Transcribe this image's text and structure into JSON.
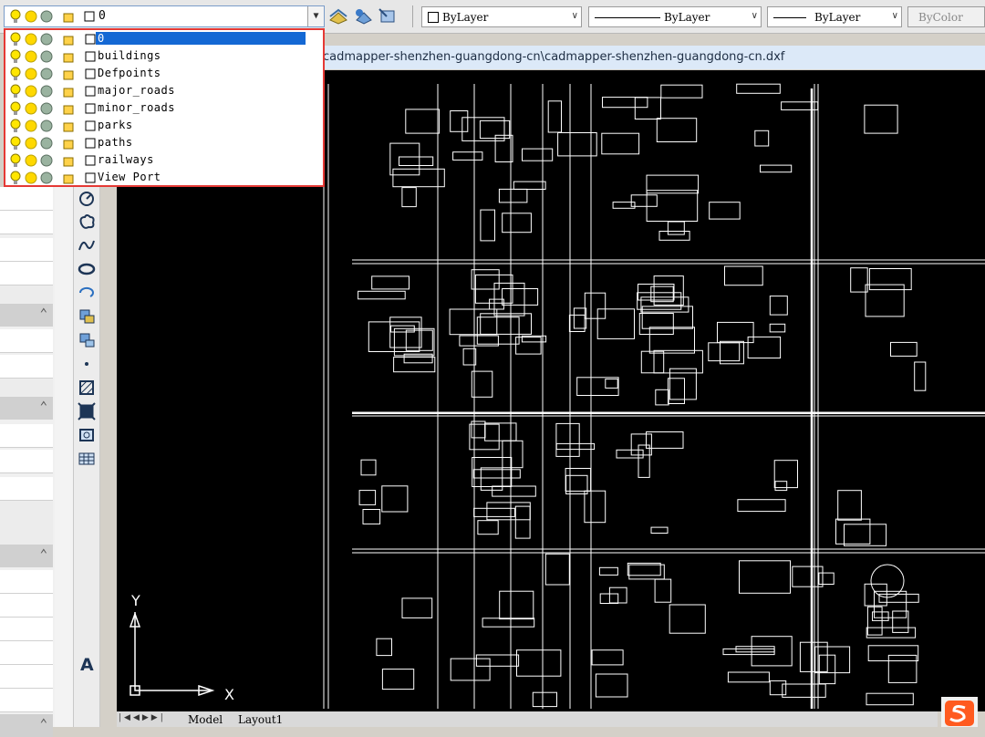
{
  "layer_combo": {
    "current_layer": "0"
  },
  "layer_list": [
    {
      "name": "0",
      "selected": true
    },
    {
      "name": "buildings",
      "selected": false
    },
    {
      "name": "Defpoints",
      "selected": false
    },
    {
      "name": "major_roads",
      "selected": false
    },
    {
      "name": "minor_roads",
      "selected": false
    },
    {
      "name": "parks",
      "selected": false
    },
    {
      "name": "paths",
      "selected": false
    },
    {
      "name": "railways",
      "selected": false
    },
    {
      "name": "View Port",
      "selected": false
    }
  ],
  "properties": {
    "color": "ByLayer",
    "linetype": "ByLayer",
    "lineweight": "ByLayer",
    "plotstyle": "ByColor"
  },
  "title": "cadmapper-shenzhen-guangdong-cn\\cadmapper-shenzhen-guangdong-cn.dxf",
  "ucs": {
    "x_label": "X",
    "y_label": "Y"
  },
  "tabs": {
    "model": "Model",
    "layout1": "Layout1"
  },
  "colors": {
    "selection": "#1468d4",
    "highlight_border": "#e53935",
    "canvas": "#000000",
    "geometry": "#ffffff"
  }
}
